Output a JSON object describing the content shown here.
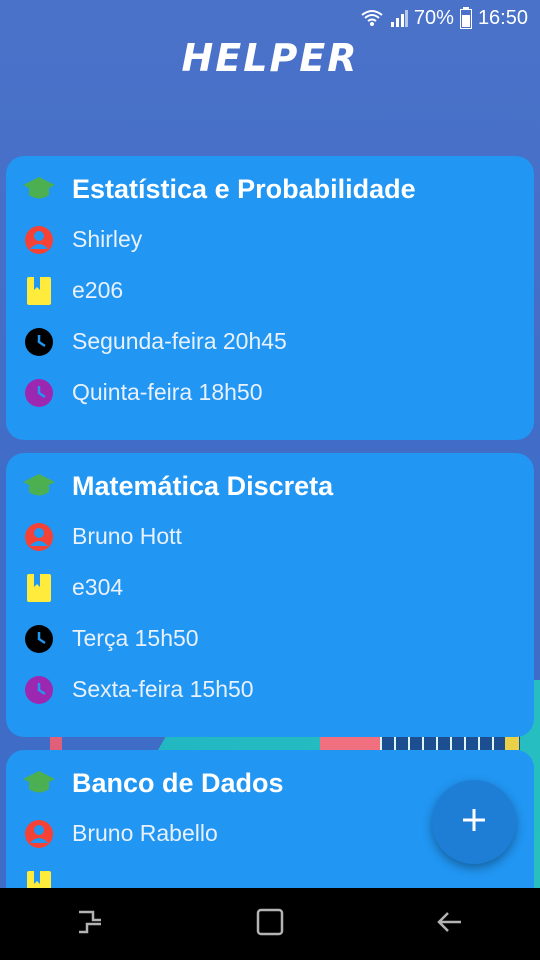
{
  "status_bar": {
    "battery_percent": "70%",
    "time": "16:50"
  },
  "app": {
    "title": "HELPER"
  },
  "cards": [
    {
      "title": "Estatística e Probabilidade",
      "professor": "Shirley",
      "room": "e206",
      "schedule_1": "Segunda-feira 20h45",
      "schedule_2": "Quinta-feira 18h50"
    },
    {
      "title": "Matemática Discreta",
      "professor": "Bruno Hott",
      "room": "e304",
      "schedule_1": "Terça 15h50",
      "schedule_2": "Sexta-feira 15h50"
    },
    {
      "title": "Banco de Dados",
      "professor": "Bruno Rabello"
    }
  ],
  "icons": {
    "course": "graduation-cap-icon",
    "professor": "person-icon",
    "room": "bookmark-icon",
    "schedule_1": "clock-icon",
    "schedule_2": "clock-icon",
    "fab": "plus-icon"
  },
  "colors": {
    "card": "#2196f3",
    "cap": "#4caf50",
    "person": "#f44336",
    "bookmark": "#ffeb3b",
    "clock_1": "#000000",
    "clock_2": "#9c27b0"
  }
}
